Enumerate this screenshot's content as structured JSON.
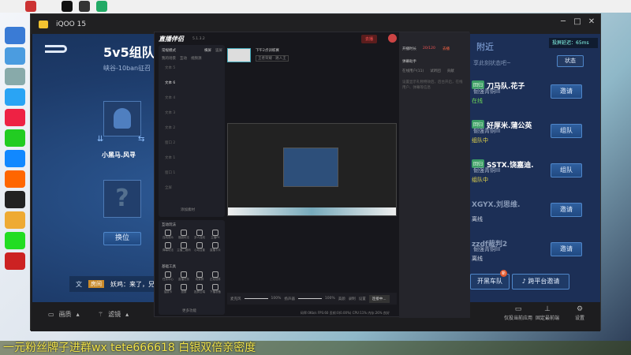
{
  "window": {
    "title": "iQOO 15"
  },
  "game": {
    "title": "5v5组队",
    "subtitle": "峡谷-10ban征召",
    "player_name": "小黑马.风寻",
    "unknown_slot": "?",
    "swap_button": "换位",
    "voice_label": "文",
    "chat_tag": "房间",
    "chat_message": "妖鸡：来了，兄",
    "nearby_title": "附近",
    "latency": "投屏延迟：65ms",
    "status_prompt": "享此刻状态吧~",
    "status_button": "状态",
    "friends": [
      {
        "tag": "回归",
        "name": "刀马队.花子",
        "rank": "倔强青铜III",
        "state": "在线",
        "state_color": "#6fdc5a",
        "action": "邀请"
      },
      {
        "tag": "回归",
        "name": "好厚米.蒲公英",
        "rank": "倔强青铜III",
        "state": "组队中",
        "state_color": "#e8d84a",
        "action": "组队"
      },
      {
        "tag": "回归",
        "name": "SSTX.饶嘉迪.",
        "rank": "倔强青铜III",
        "state": "组队中",
        "state_color": "#e8d84a",
        "action": "组队"
      },
      {
        "tag": "",
        "name": "XGYX.刘思维.",
        "rank": "",
        "state": "离线",
        "state_color": "#cfd6e2",
        "action": "邀请"
      },
      {
        "tag": "",
        "name": "zzdf裁判2",
        "rank": "倔强青铜III",
        "state": "离线",
        "state_color": "#cfd6e2",
        "action": "邀请"
      }
    ],
    "team_button": "开黑车队",
    "team_badge": "新",
    "cross_platform_button": "跨平台邀请"
  },
  "toolbar": {
    "quality": "画质",
    "filter": "滤镜",
    "items": [
      "仅投当前应用",
      "固定最前端",
      "设置"
    ]
  },
  "streamer": {
    "app_name": "直播伴侣",
    "version": "5.1.3.2",
    "go_live": "去播",
    "room_title": "下午2点训练赛",
    "category": "王者荣耀 · 路人王",
    "mode": "常规模式",
    "scene_tabs": [
      "横屏",
      "竖屏"
    ],
    "source_tabs": [
      "我的场景",
      "互动",
      "视频源"
    ],
    "sources": [
      "文本 5",
      "文本 6",
      "文本 4",
      "文本 3",
      "文本 2",
      "窗口 2",
      "文本 1",
      "窗口 1",
      "全屏"
    ],
    "add_source": "添加素材",
    "interactive_title": "互动玩法",
    "interactive": [
      "连线观众",
      "福袋玩法",
      "多人连线",
      "主播PK",
      "弹幕玩法",
      "主播二维码",
      "心动召集",
      "直播卡片"
    ],
    "tools_title": "基础工具",
    "tools": [
      "任务中心",
      "直播任务",
      "玩家群",
      "正经插件",
      "抽奖卡",
      "投屏",
      "投屏云端",
      "下播准备"
    ],
    "more_tools": "更多功能",
    "mic_label": "麦克风",
    "mic_level": "100%",
    "speaker_label": "扬声器",
    "speaker_level": "100%",
    "bottom_btns": [
      "美颜",
      "录制",
      "设置"
    ],
    "live_button": "连接中...",
    "stats": "码率:0Kb/s  FPS:60  丢帧:0(0.00%)  CPU:11%  内存:26%  良好",
    "right": {
      "online": "开播时长",
      "count": "20/120",
      "hot": "去播",
      "tabs": [
        "在线用户(11)",
        "试听团",
        "贡献"
      ],
      "panel_title": "弹幕助手",
      "hint": "设置显示礼物特效后，后台开启，在线用户、弹幕等信息"
    }
  },
  "caption": "一元粉丝牌子进群wx tete666618 白银双倍亲密度"
}
